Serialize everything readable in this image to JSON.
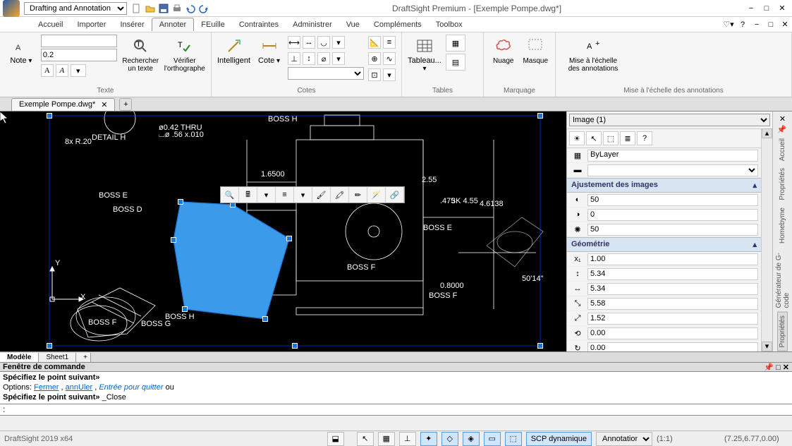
{
  "title": "DraftSight Premium - [Exemple Pompe.dwg*]",
  "workspace": "Drafting and Annotation",
  "menus": [
    "Accueil",
    "Importer",
    "Insérer",
    "Annoter",
    "FEuille",
    "Contraintes",
    "Administrer",
    "Vue",
    "Compléments",
    "Toolbox"
  ],
  "active_menu": "Annoter",
  "ribbon": {
    "texte": {
      "title": "Texte",
      "note": "Note",
      "rechercher": "Rechercher\nun texte",
      "verifier": "Vérifier\nl'orthographe",
      "field_top": "",
      "field_scale": "0.2"
    },
    "cotes": {
      "title": "Cotes",
      "intelligent": "Intelligent",
      "cote": "Cote"
    },
    "tables": {
      "title": "Tables",
      "tableau": "Tableau..."
    },
    "marquage": {
      "title": "Marquage",
      "nuage": "Nuage",
      "masque": "Masque"
    },
    "echelle": {
      "title": "Mise à l'échelle des annotations",
      "label": "Mise à l'échelle\ndes annotations"
    }
  },
  "doctab": {
    "name": "Exemple Pompe.dwg*"
  },
  "canvas_labels": {
    "detail_h": "DETAIL H",
    "boss_e1": "BOSS E",
    "boss_d": "BOSS D",
    "boss_h": "BOSS H",
    "boss_e2": "BOSS E",
    "boss_g": "BOSS G",
    "boss_f": "BOSS F",
    "boss_f2": "BOSS F",
    "xlabel": "X",
    "ylabel": "Y",
    "dim1": "1.6500",
    "dim2": "4.6138",
    "dim3": "0.8000",
    "dim4": ".475",
    "dim5": "2.55",
    "dim6": "3K 4.55",
    "dim7": "50'14\"",
    "r20": "8x R.20",
    "thru": "ø0.42  THRU",
    "cb1": "⌴ø .56 x.010"
  },
  "props": {
    "selector": "Image (1)",
    "bylayer": "ByLayer",
    "sec_image": "Ajustement des images",
    "img_bright": "50",
    "img_contrast": "0",
    "img_fade": "50",
    "sec_geom": "Géométrie",
    "g1": "1.00",
    "g2": "5.34",
    "g3": "5.34",
    "g4": "5.58",
    "g5": "1.52",
    "g6": "0.00",
    "g7": "0.00"
  },
  "rside": [
    "Accueil",
    "Propriétés",
    "Homebyme",
    "Générateur de G-code",
    "Propriétés"
  ],
  "sheets": {
    "model": "Modèle",
    "sheet1": "Sheet1"
  },
  "cmd": {
    "header": "Fenêtre de commande",
    "line1_b": "Spécifiez le point suivant»",
    "line2_pre": "Options: ",
    "line2_a": "Fermer",
    "line2_sep": ", ",
    "line2_b": "annUler",
    "line2_c": "Entrée pour quitter",
    "line2_post": " ou",
    "line3_b": "Spécifiez le point suivant»",
    "line3_c": " _Close",
    "prompt": ":"
  },
  "status": {
    "app": "DraftSight 2019 x64",
    "scp": "SCP dynamique",
    "anno": "Annotation",
    "ratio": "(1:1)",
    "coord": "(7.25,6.77,0.00)"
  }
}
